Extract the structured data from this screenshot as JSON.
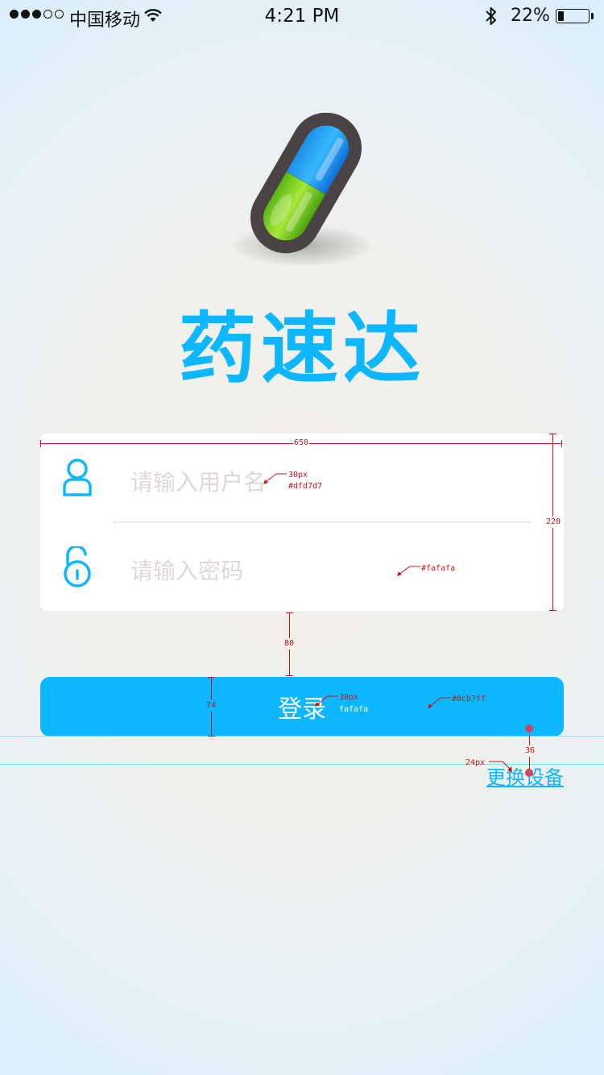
{
  "status_bar": {
    "carrier": "中国移动",
    "time": "4:21 PM",
    "battery_percent": "22%",
    "battery_level": 0.22,
    "signal_bars_filled": 3,
    "signal_bars_total": 5,
    "icons": [
      "wifi-icon",
      "bluetooth-icon",
      "battery-icon"
    ]
  },
  "app": {
    "name": "药速达",
    "logo_icon": "capsule-pill-icon"
  },
  "form": {
    "username_placeholder": "请输入用户名",
    "password_placeholder": "请输入密码",
    "username_icon": "user-icon",
    "password_icon": "unlock-icon"
  },
  "actions": {
    "login_label": "登录",
    "change_device_label": "更换设备"
  },
  "colors": {
    "accent": "#0cb7ff",
    "placeholder": "#dfd7d7",
    "card_bg": "#fafafa",
    "button_text": "#fafafa",
    "annotation": "#c8141e"
  },
  "annotations": {
    "card_width": "650",
    "card_height": "220",
    "gap_card_button": "80",
    "button_height": "74",
    "gap_button_link": "36",
    "placeholder_size": "30px",
    "placeholder_color": "#dfd7d7",
    "card_color": "#fafafa",
    "button_text_size": "30px",
    "button_text_color": "fafafa",
    "button_color": "#0cb7ff",
    "link_size": "24px"
  }
}
